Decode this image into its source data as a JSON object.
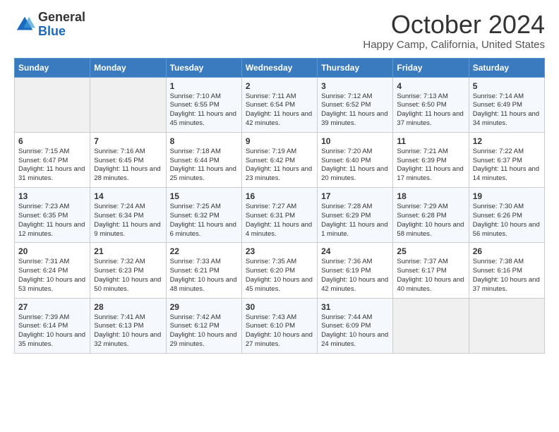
{
  "header": {
    "logo_general": "General",
    "logo_blue": "Blue",
    "month_title": "October 2024",
    "location": "Happy Camp, California, United States"
  },
  "days_of_week": [
    "Sunday",
    "Monday",
    "Tuesday",
    "Wednesday",
    "Thursday",
    "Friday",
    "Saturday"
  ],
  "weeks": [
    [
      {
        "day": "",
        "info": ""
      },
      {
        "day": "",
        "info": ""
      },
      {
        "day": "1",
        "info": "Sunrise: 7:10 AM\nSunset: 6:55 PM\nDaylight: 11 hours and 45 minutes."
      },
      {
        "day": "2",
        "info": "Sunrise: 7:11 AM\nSunset: 6:54 PM\nDaylight: 11 hours and 42 minutes."
      },
      {
        "day": "3",
        "info": "Sunrise: 7:12 AM\nSunset: 6:52 PM\nDaylight: 11 hours and 39 minutes."
      },
      {
        "day": "4",
        "info": "Sunrise: 7:13 AM\nSunset: 6:50 PM\nDaylight: 11 hours and 37 minutes."
      },
      {
        "day": "5",
        "info": "Sunrise: 7:14 AM\nSunset: 6:49 PM\nDaylight: 11 hours and 34 minutes."
      }
    ],
    [
      {
        "day": "6",
        "info": "Sunrise: 7:15 AM\nSunset: 6:47 PM\nDaylight: 11 hours and 31 minutes."
      },
      {
        "day": "7",
        "info": "Sunrise: 7:16 AM\nSunset: 6:45 PM\nDaylight: 11 hours and 28 minutes."
      },
      {
        "day": "8",
        "info": "Sunrise: 7:18 AM\nSunset: 6:44 PM\nDaylight: 11 hours and 25 minutes."
      },
      {
        "day": "9",
        "info": "Sunrise: 7:19 AM\nSunset: 6:42 PM\nDaylight: 11 hours and 23 minutes."
      },
      {
        "day": "10",
        "info": "Sunrise: 7:20 AM\nSunset: 6:40 PM\nDaylight: 11 hours and 20 minutes."
      },
      {
        "day": "11",
        "info": "Sunrise: 7:21 AM\nSunset: 6:39 PM\nDaylight: 11 hours and 17 minutes."
      },
      {
        "day": "12",
        "info": "Sunrise: 7:22 AM\nSunset: 6:37 PM\nDaylight: 11 hours and 14 minutes."
      }
    ],
    [
      {
        "day": "13",
        "info": "Sunrise: 7:23 AM\nSunset: 6:35 PM\nDaylight: 11 hours and 12 minutes."
      },
      {
        "day": "14",
        "info": "Sunrise: 7:24 AM\nSunset: 6:34 PM\nDaylight: 11 hours and 9 minutes."
      },
      {
        "day": "15",
        "info": "Sunrise: 7:25 AM\nSunset: 6:32 PM\nDaylight: 11 hours and 6 minutes."
      },
      {
        "day": "16",
        "info": "Sunrise: 7:27 AM\nSunset: 6:31 PM\nDaylight: 11 hours and 4 minutes."
      },
      {
        "day": "17",
        "info": "Sunrise: 7:28 AM\nSunset: 6:29 PM\nDaylight: 11 hours and 1 minute."
      },
      {
        "day": "18",
        "info": "Sunrise: 7:29 AM\nSunset: 6:28 PM\nDaylight: 10 hours and 58 minutes."
      },
      {
        "day": "19",
        "info": "Sunrise: 7:30 AM\nSunset: 6:26 PM\nDaylight: 10 hours and 56 minutes."
      }
    ],
    [
      {
        "day": "20",
        "info": "Sunrise: 7:31 AM\nSunset: 6:24 PM\nDaylight: 10 hours and 53 minutes."
      },
      {
        "day": "21",
        "info": "Sunrise: 7:32 AM\nSunset: 6:23 PM\nDaylight: 10 hours and 50 minutes."
      },
      {
        "day": "22",
        "info": "Sunrise: 7:33 AM\nSunset: 6:21 PM\nDaylight: 10 hours and 48 minutes."
      },
      {
        "day": "23",
        "info": "Sunrise: 7:35 AM\nSunset: 6:20 PM\nDaylight: 10 hours and 45 minutes."
      },
      {
        "day": "24",
        "info": "Sunrise: 7:36 AM\nSunset: 6:19 PM\nDaylight: 10 hours and 42 minutes."
      },
      {
        "day": "25",
        "info": "Sunrise: 7:37 AM\nSunset: 6:17 PM\nDaylight: 10 hours and 40 minutes."
      },
      {
        "day": "26",
        "info": "Sunrise: 7:38 AM\nSunset: 6:16 PM\nDaylight: 10 hours and 37 minutes."
      }
    ],
    [
      {
        "day": "27",
        "info": "Sunrise: 7:39 AM\nSunset: 6:14 PM\nDaylight: 10 hours and 35 minutes."
      },
      {
        "day": "28",
        "info": "Sunrise: 7:41 AM\nSunset: 6:13 PM\nDaylight: 10 hours and 32 minutes."
      },
      {
        "day": "29",
        "info": "Sunrise: 7:42 AM\nSunset: 6:12 PM\nDaylight: 10 hours and 29 minutes."
      },
      {
        "day": "30",
        "info": "Sunrise: 7:43 AM\nSunset: 6:10 PM\nDaylight: 10 hours and 27 minutes."
      },
      {
        "day": "31",
        "info": "Sunrise: 7:44 AM\nSunset: 6:09 PM\nDaylight: 10 hours and 24 minutes."
      },
      {
        "day": "",
        "info": ""
      },
      {
        "day": "",
        "info": ""
      }
    ]
  ]
}
